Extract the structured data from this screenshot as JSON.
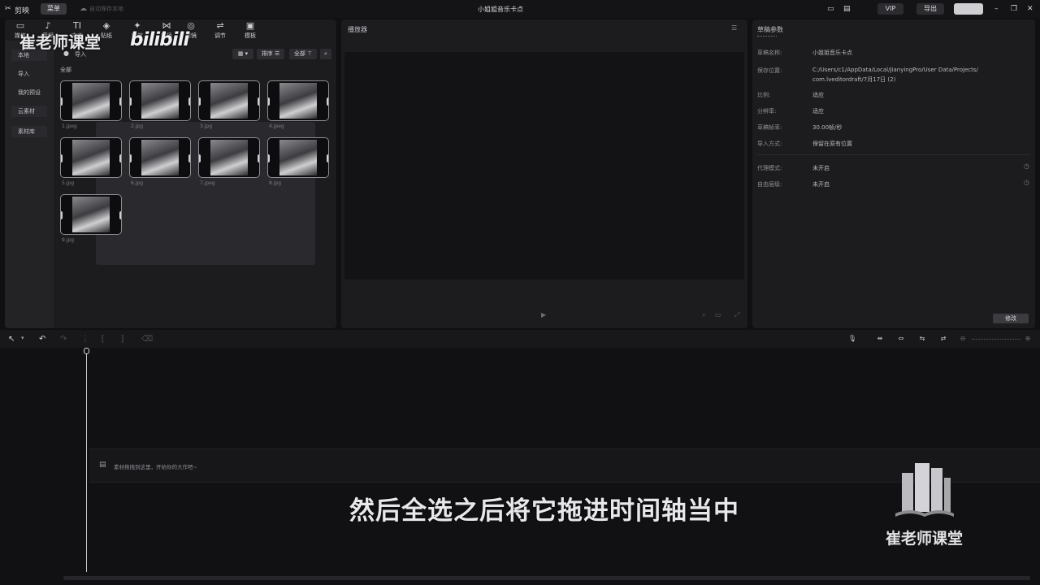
{
  "titlebar": {
    "app_name": "剪映",
    "menu_label": "菜单",
    "autosave_text": "自动保存本地",
    "project_title": "小姐姐音乐卡点",
    "vip_label": "VIP",
    "export_label": "导出"
  },
  "tools": [
    {
      "icon": "media-icon",
      "label": "媒体"
    },
    {
      "icon": "audio-icon",
      "label": "音频"
    },
    {
      "icon": "text-icon",
      "label": "文本"
    },
    {
      "icon": "sticker-icon",
      "label": "贴纸"
    },
    {
      "icon": "effects-icon",
      "label": "特效"
    },
    {
      "icon": "transition-icon",
      "label": "转场"
    },
    {
      "icon": "filter-icon",
      "label": "滤镜"
    },
    {
      "icon": "adjust-icon",
      "label": "调节"
    },
    {
      "icon": "template-icon",
      "label": "模板"
    }
  ],
  "sidebar": {
    "items": [
      "本地",
      "导入",
      "我的预设",
      "云素材",
      "素材库"
    ]
  },
  "media": {
    "import_label": "导入",
    "section_label": "全部",
    "sort_label": "排序",
    "all_label": "全部",
    "files": [
      "1.jpeg",
      "2.jpg",
      "3.jpg",
      "4.jpeg",
      "5.jpg",
      "6.jpg",
      "7.jpeg",
      "8.jpg",
      "9.jpg"
    ]
  },
  "player": {
    "title": "播放器"
  },
  "params": {
    "title": "草稿参数",
    "rows": [
      {
        "label": "草稿名称:",
        "value": "小姐姐音乐卡点"
      },
      {
        "label": "保存位置:",
        "value": "C:/Users/c1/AppData/Local/JianyingPro/User Data/Projects/"
      },
      {
        "label": "",
        "value": "com.lveditordraft/7月17日 (2)"
      },
      {
        "label": "比例:",
        "value": "适应"
      },
      {
        "label": "分辨率:",
        "value": "适应"
      },
      {
        "label": "草稿帧率:",
        "value": "30.00帧/秒"
      },
      {
        "label": "导入方式:",
        "value": "保留在原有位置"
      },
      {
        "label": "代理模式:",
        "value": "未开启"
      },
      {
        "label": "自由层级:",
        "value": "未开启"
      }
    ],
    "modify_label": "修改"
  },
  "timeline": {
    "track_hint": "素材拖拽到这里，开始你的大作吧~"
  },
  "overlay": {
    "watermark": "崔老师课堂",
    "bili": "bilibili",
    "subtitle": "然后全选之后将它拖进时间轴当中",
    "logo_text": "崔老师课堂"
  }
}
